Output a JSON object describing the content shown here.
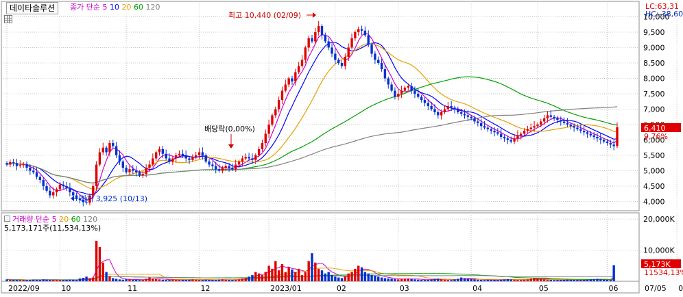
{
  "stock_name": "데이타솔루션",
  "price_legend": {
    "prefix": "종가 단순",
    "ma": [
      {
        "label": "5",
        "color": "#cc00cc"
      },
      {
        "label": "10",
        "color": "#0000ff"
      },
      {
        "label": "20",
        "color": "#e8a000"
      },
      {
        "label": "60",
        "color": "#00a000"
      },
      {
        "label": "120",
        "color": "#808080"
      }
    ]
  },
  "volume_legend": {
    "prefix": "거래량 단순",
    "ma": [
      {
        "label": "5",
        "color": "#cc00cc"
      },
      {
        "label": "20",
        "color": "#e8a000"
      },
      {
        "label": "60",
        "color": "#00a000"
      },
      {
        "label": "120",
        "color": "#808080"
      }
    ]
  },
  "lc": "LC:63,31",
  "hc": "HC:-38,60",
  "volume_info": "5,173,171주(11,534,13%)",
  "high_label": "최고 10,440 (02/09)",
  "low_label": "최저 3,925 (10/13)",
  "dividend_label": "배당락(0,00%)",
  "price_tag": "6,410",
  "pct_tag": "9,76%",
  "vol_tag": "5,173K",
  "vol_pct_tag": "11534,13%",
  "colors": {
    "up": "#e00000",
    "down": "#0030d0",
    "ma5": "#cc00cc",
    "ma10": "#0000ff",
    "ma20": "#e8a000",
    "ma60": "#00a000",
    "ma120": "#808080"
  },
  "chart_data": [
    {
      "type": "candlestick",
      "title": "",
      "y_ticks": [
        "4,000",
        "4,500",
        "5,000",
        "5,500",
        "6,000",
        "6,500",
        "7,000",
        "7,500",
        "8,000",
        "8,500",
        "9,000",
        "9,500",
        "10,000"
      ],
      "ylim": [
        3700,
        10500
      ],
      "x_ticks": [
        {
          "label": "2022/09",
          "i": 0
        },
        {
          "label": "10",
          "i": 16
        },
        {
          "label": "11",
          "i": 36
        },
        {
          "label": "12",
          "i": 58
        },
        {
          "label": "2023/01",
          "i": 79
        },
        {
          "label": "02",
          "i": 99
        },
        {
          "label": "03",
          "i": 118
        },
        {
          "label": "04",
          "i": 140
        },
        {
          "label": "05",
          "i": 160
        },
        {
          "label": "06",
          "i": 181
        },
        {
          "label": "07",
          "i": 202
        },
        {
          "label": "07/05",
          "i": 208
        }
      ],
      "close": [
        5200,
        5280,
        5250,
        5150,
        5180,
        5220,
        5100,
        5000,
        4950,
        4800,
        4700,
        4500,
        4350,
        4200,
        4300,
        4400,
        4550,
        4500,
        4450,
        4300,
        4200,
        4100,
        4050,
        3980,
        3960,
        4200,
        4500,
        5200,
        5600,
        5750,
        5600,
        5900,
        5800,
        5500,
        5300,
        5100,
        4950,
        5050,
        5000,
        4950,
        4850,
        4900,
        5100,
        5200,
        5400,
        5600,
        5700,
        5550,
        5400,
        5300,
        5400,
        5500,
        5550,
        5500,
        5400,
        5350,
        5450,
        5500,
        5600,
        5500,
        5300,
        5200,
        5150,
        5050,
        5000,
        5100,
        5150,
        5100,
        5050,
        5200,
        5300,
        5400,
        5450,
        5400,
        5350,
        5500,
        5700,
        5900,
        6200,
        6500,
        6800,
        7000,
        7300,
        7600,
        7800,
        8000,
        7900,
        8200,
        8400,
        8600,
        9000,
        9300,
        9200,
        9500,
        9700,
        9400,
        9200,
        9000,
        8800,
        8600,
        8500,
        8400,
        8700,
        9000,
        9300,
        9500,
        9600,
        9550,
        9400,
        9100,
        8800,
        8600,
        8500,
        8300,
        8000,
        7800,
        7600,
        7400,
        7500,
        7600,
        7700,
        7750,
        7600,
        7500,
        7400,
        7300,
        7200,
        7100,
        7000,
        6900,
        6800,
        6900,
        7000,
        7100,
        7050,
        7000,
        6900,
        6850,
        6800,
        6750,
        6700,
        6600,
        6550,
        6450,
        6400,
        6350,
        6300,
        6250,
        6200,
        6100,
        6050,
        6000,
        5950,
        6050,
        6150,
        6200,
        6300,
        6350,
        6400,
        6450,
        6500,
        6600,
        6700,
        6800,
        6750,
        6700,
        6650,
        6600,
        6550,
        6500,
        6450,
        6400,
        6350,
        6300,
        6250,
        6200,
        6150,
        6100,
        6050,
        6000,
        5950,
        5900,
        5850,
        5800,
        6410
      ],
      "open": [
        5250,
        5200,
        5280,
        5250,
        5150,
        5180,
        5220,
        5100,
        5000,
        4950,
        4800,
        4700,
        4500,
        4350,
        4200,
        4300,
        4400,
        4550,
        4500,
        4450,
        4300,
        4200,
        4100,
        4050,
        3980,
        3960,
        4200,
        4500,
        5200,
        5600,
        5750,
        5600,
        5900,
        5800,
        5500,
        5300,
        5100,
        4950,
        5050,
        5000,
        4950,
        4850,
        4900,
        5100,
        5200,
        5400,
        5600,
        5700,
        5550,
        5400,
        5300,
        5400,
        5500,
        5550,
        5500,
        5400,
        5350,
        5450,
        5500,
        5600,
        5500,
        5300,
        5200,
        5150,
        5050,
        5000,
        5100,
        5150,
        5100,
        5050,
        5200,
        5300,
        5400,
        5450,
        5400,
        5350,
        5500,
        5700,
        5900,
        6200,
        6500,
        6800,
        7000,
        7300,
        7600,
        7800,
        8000,
        7900,
        8200,
        8400,
        8600,
        9000,
        9300,
        9200,
        9500,
        9700,
        9400,
        9200,
        9000,
        8800,
        8600,
        8500,
        8400,
        8700,
        9000,
        9300,
        9500,
        9600,
        9550,
        9400,
        9100,
        8800,
        8600,
        8500,
        8300,
        8000,
        7800,
        7600,
        7400,
        7500,
        7600,
        7700,
        7750,
        7600,
        7500,
        7400,
        7300,
        7200,
        7100,
        7000,
        6900,
        6800,
        6900,
        7000,
        7100,
        7050,
        7000,
        6900,
        6850,
        6800,
        6750,
        6700,
        6600,
        6550,
        6450,
        6400,
        6350,
        6300,
        6250,
        6200,
        6100,
        6050,
        6000,
        5950,
        6050,
        6150,
        6200,
        6300,
        6350,
        6400,
        6450,
        6500,
        6600,
        6700,
        6800,
        6750,
        6700,
        6650,
        6600,
        6550,
        6500,
        6450,
        6400,
        6350,
        6300,
        6250,
        6200,
        6150,
        6100,
        6050,
        6000,
        5950,
        5900,
        5850,
        5800
      ],
      "volume_ylim": [
        0,
        22000
      ],
      "volume_ticks": [
        "10,000K",
        "20,000K"
      ],
      "volume": [
        600,
        500,
        450,
        400,
        420,
        380,
        400,
        450,
        500,
        480,
        420,
        600,
        500,
        450,
        400,
        420,
        380,
        400,
        450,
        500,
        480,
        420,
        900,
        1100,
        1500,
        800,
        1200,
        13000,
        11000,
        6000,
        3000,
        1500,
        1000,
        800,
        600,
        500,
        700,
        600,
        500,
        450,
        400,
        500,
        800,
        1200,
        900,
        700,
        600,
        500,
        450,
        400,
        600,
        500,
        450,
        400,
        450,
        500,
        600,
        500,
        450,
        400,
        500,
        450,
        400,
        450,
        500,
        600,
        500,
        450,
        400,
        500,
        600,
        800,
        1000,
        1500,
        2000,
        3000,
        2500,
        2000,
        3000,
        5000,
        4000,
        6500,
        3500,
        5500,
        3000,
        4500,
        3800,
        3000,
        4000,
        2000,
        3000,
        6500,
        9000,
        6000,
        4000,
        3500,
        2500,
        3000,
        2000,
        1500,
        1200,
        1000,
        1500,
        2500,
        3000,
        4000,
        5000,
        4500,
        3000,
        2500,
        2000,
        1800,
        1500,
        1200,
        1000,
        900,
        800,
        700,
        600,
        700,
        800,
        900,
        700,
        600,
        500,
        450,
        400,
        500,
        600,
        700,
        800,
        600,
        500,
        450,
        400,
        600,
        800,
        1200,
        1000,
        800,
        700,
        600,
        500,
        450,
        400,
        500,
        450,
        400,
        350,
        500,
        600,
        700,
        600,
        500,
        450,
        400,
        500,
        600,
        800,
        1000,
        900,
        700,
        600,
        500,
        450,
        400,
        350,
        400,
        450,
        500,
        450,
        400,
        350,
        400,
        450,
        500,
        600,
        700,
        800,
        600,
        500,
        450,
        400,
        5173
      ]
    }
  ]
}
